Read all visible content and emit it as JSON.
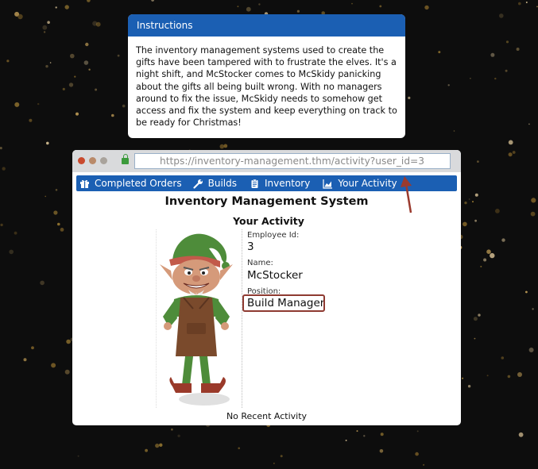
{
  "instructions": {
    "title": "Instructions",
    "body": "The inventory management systems used to create the gifts have been tampered with to frustrate the elves. It's a night shift, and McStocker comes to McSkidy panicking about the gifts all being built wrong. With no managers around to fix the issue, McSkidy needs to somehow get access and fix the system and keep everything on track to be ready for Christmas!"
  },
  "browser": {
    "url": "https://inventory-management.thm/activity?user_id=3"
  },
  "nav": {
    "items": [
      {
        "label": "Completed Orders",
        "icon": "gift-icon"
      },
      {
        "label": "Builds",
        "icon": "wrench-icon"
      },
      {
        "label": "Inventory",
        "icon": "clipboard-icon"
      },
      {
        "label": "Your Activity",
        "icon": "chart-icon"
      }
    ]
  },
  "page": {
    "app_title": "Inventory Management System",
    "section_title": "Your Activity",
    "employee_id_label": "Employee Id:",
    "employee_id_value": "3",
    "name_label": "Name:",
    "name_value": "McStocker",
    "position_label": "Position:",
    "position_value": "Build Manager",
    "recent_activity": "No Recent Activity"
  },
  "colors": {
    "accent_blue": "#1b5fb3",
    "highlight": "#8e3a31",
    "background": "#0d0d0d"
  }
}
